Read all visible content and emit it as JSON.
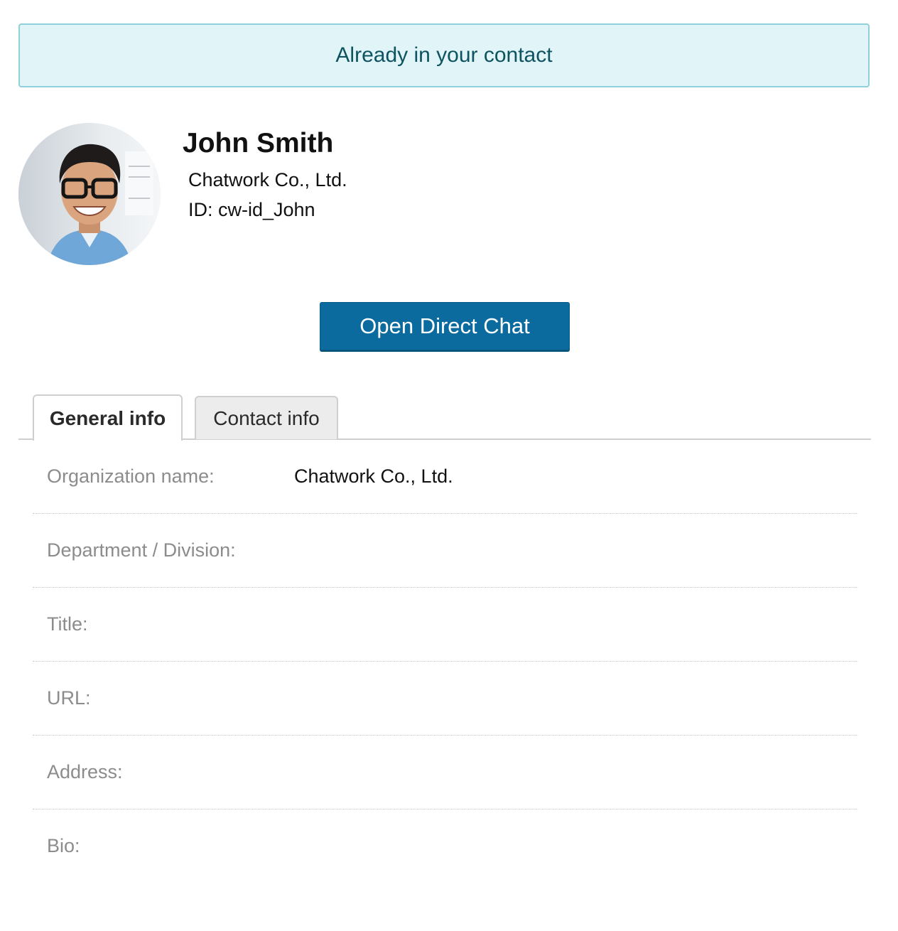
{
  "notice": {
    "text": "Already in your contact"
  },
  "profile": {
    "name": "John Smith",
    "organization": "Chatwork Co., Ltd.",
    "id_line": "ID: cw-id_John"
  },
  "actions": {
    "open_chat_label": "Open Direct Chat"
  },
  "tabs": [
    {
      "label": "General info",
      "active": true
    },
    {
      "label": "Contact info",
      "active": false
    }
  ],
  "general_info": [
    {
      "label": "Organization name:",
      "value": "Chatwork Co., Ltd."
    },
    {
      "label": "Department / Division:",
      "value": ""
    },
    {
      "label": "Title:",
      "value": ""
    },
    {
      "label": "URL:",
      "value": ""
    },
    {
      "label": "Address:",
      "value": ""
    },
    {
      "label": "Bio:",
      "value": ""
    }
  ],
  "colors": {
    "notice_background": "#e1f5f9",
    "notice_border": "#8fd0da",
    "notice_text": "#0e5360",
    "primary_button": "#0b6b9e",
    "label_text": "#8c8c8c"
  },
  "icons": {
    "avatar": "user-photo-avatar"
  }
}
